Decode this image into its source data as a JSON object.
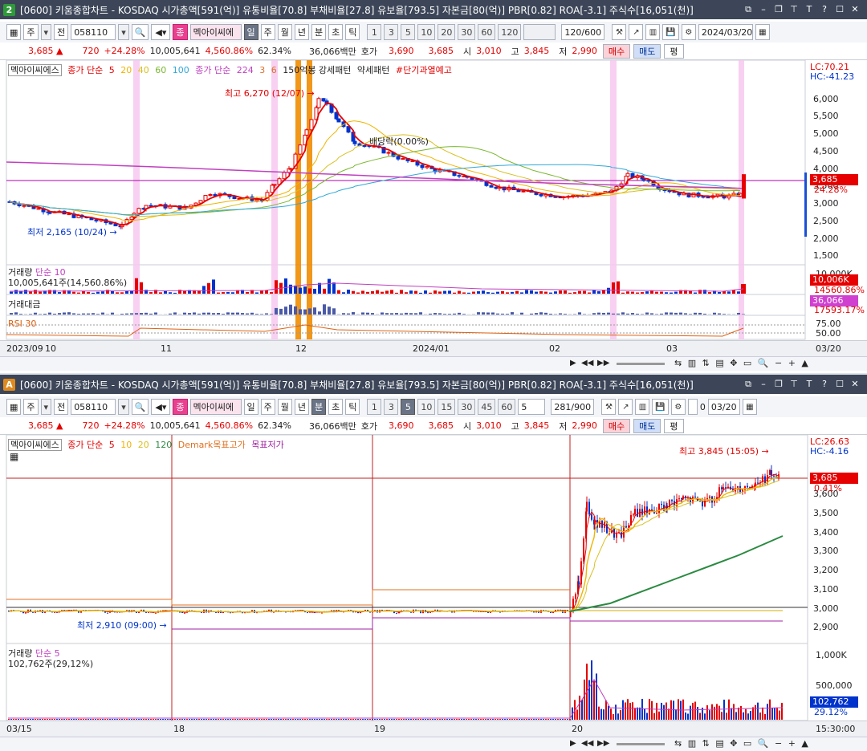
{
  "top": {
    "badge": "2",
    "badge_color": "#2f9a3a",
    "title": "[0600] 키움종합차트 - KOSDAQ 시가총액[591(억)] 유통비율[70.8] 부채비율[27.8] 유보율[793.5] 자본금[80(억)] PBR[0.82] ROA[-3.1] 주식수[16,051(천)]",
    "toolbar": {
      "market": "주",
      "prev": "전",
      "code": "058110",
      "name": "멕아이씨에",
      "stock_btn": "종",
      "periods": [
        "일",
        "주",
        "월",
        "년",
        "분",
        "초",
        "틱"
      ],
      "selected_period": "일",
      "intervals": [
        "1",
        "3",
        "5",
        "10",
        "20",
        "30",
        "60",
        "120"
      ],
      "count": "120/600",
      "date": "2024/03/20"
    },
    "quote": {
      "price": "3,685",
      "change": "720",
      "change_pct": "+24.28%",
      "volume": "10,005,641",
      "vol_ratio": "4,560.86%",
      "turnover": "62.34%",
      "amount": "36,066백만",
      "hoga_label": "호가",
      "ask": "3,690",
      "bid": "3,685",
      "open_label": "시",
      "open": "3,010",
      "high_label": "고",
      "high": "3,845",
      "low_label": "저",
      "low": "2,990",
      "buy": "매수",
      "sell": "매도",
      "flat": "평"
    },
    "legend": {
      "name": "멕아이씨에스",
      "ma_label": "종가 단순",
      "ma": [
        "5",
        "20",
        "40",
        "60",
        "100"
      ],
      "ma2_label": "종가 단순",
      "ma2": [
        "224",
        "3",
        "6"
      ],
      "pattern": "150억봉 강세패턴",
      "weak": "약세패턴",
      "warn": "#단기과열예고"
    },
    "lc": "LC:70.21",
    "hc": "HC:-41.23",
    "high_note": "최고 6,270 (12/07)",
    "low_note": "최저 2,165 (10/24)",
    "div_note": "배당락(0.00%)",
    "price_tag": "3,685",
    "pct_tag": "24.28%",
    "y_ticks": [
      "6,000",
      "5,500",
      "5,000",
      "4,500",
      "4,000",
      "3,500",
      "3,000",
      "2,500",
      "2,000",
      "1,500"
    ],
    "volume_title": "거래량",
    "volume_ma": "단순 10",
    "volume_value": "10,005,641주(14,560.86%)",
    "vol_tag": "10,006K",
    "vol_tag2": "14560.86%",
    "vol_tick": "10,000K",
    "amount_title": "거래대금",
    "amount_tag": "36,066",
    "amount_tag2": "17593.17%",
    "rsi_title": "RSI 30",
    "rsi_ticks": [
      "75.00",
      "50.00"
    ],
    "x_ticks": [
      "2023/09",
      "10",
      "11",
      "12",
      "2024/01",
      "02",
      "03"
    ],
    "x_right": "03/20"
  },
  "bottom": {
    "badge": "A",
    "badge_color": "#e08a1e",
    "title": "[0600] 키움종합차트 - KOSDAQ 시가총액[591(억)] 유통비율[70.8] 부채비율[27.8] 유보율[793.5] 자본금[80(억)] PBR[0.82] ROA[-3.1] 주식수[16,051(천)]",
    "toolbar": {
      "market": "주",
      "prev": "전",
      "code": "058110",
      "name": "멕아이씨에",
      "stock_btn": "종",
      "periods": [
        "일",
        "주",
        "월",
        "년",
        "분",
        "초",
        "틱"
      ],
      "selected_period": "분",
      "intervals": [
        "1",
        "3",
        "5",
        "10",
        "15",
        "30",
        "45",
        "60"
      ],
      "selected_interval": "5",
      "step": "5",
      "count": "281/900",
      "date": "03/20",
      "zero": "0"
    },
    "quote": {
      "price": "3,685",
      "change": "720",
      "change_pct": "+24.28%",
      "volume": "10,005,641",
      "vol_ratio": "4,560.86%",
      "turnover": "62.34%",
      "amount": "36,066백만",
      "hoga_label": "호가",
      "ask": "3,690",
      "bid": "3,685",
      "open_label": "시",
      "open": "3,010",
      "high_label": "고",
      "high": "3,845",
      "low_label": "저",
      "low": "2,990",
      "buy": "매수",
      "sell": "매도",
      "flat": "평"
    },
    "legend": {
      "name": "멕아이씨에스",
      "ma_label": "종가 단순",
      "ma": [
        "5",
        "10",
        "20",
        "120"
      ],
      "demark": "Demark목표고가",
      "demark_low": "목표저가"
    },
    "lc": "LC:26.63",
    "hc": "HC:-4.16",
    "high_note": "최고 3,845 (15:05)",
    "low_note": "최저 2,910 (09:00)",
    "price_tag": "3,685",
    "pct_tag": "0.41%",
    "y_ticks": [
      "3,600",
      "3,500",
      "3,400",
      "3,300",
      "3,200",
      "3,100",
      "3,000",
      "2,900"
    ],
    "volume_title": "거래량",
    "volume_ma": "단순 5",
    "volume_value": "102,762주(29,12%)",
    "vol_ticks": [
      "1,000K",
      "500,000"
    ],
    "vol_tag": "102,762",
    "vol_tag2": "29.12%",
    "x_ticks": [
      "03/15",
      "18",
      "19",
      "20"
    ],
    "x_right": "15:30:00"
  },
  "colors": {
    "up": "#e60000",
    "down": "#0033cc",
    "ma5": "#e60000",
    "ma20": "#f0b400",
    "ma40": "#d8c020",
    "ma60": "#7ab830",
    "ma100": "#30a8d8",
    "ma224": "#c040c0",
    "orange": "#f08c00"
  }
}
